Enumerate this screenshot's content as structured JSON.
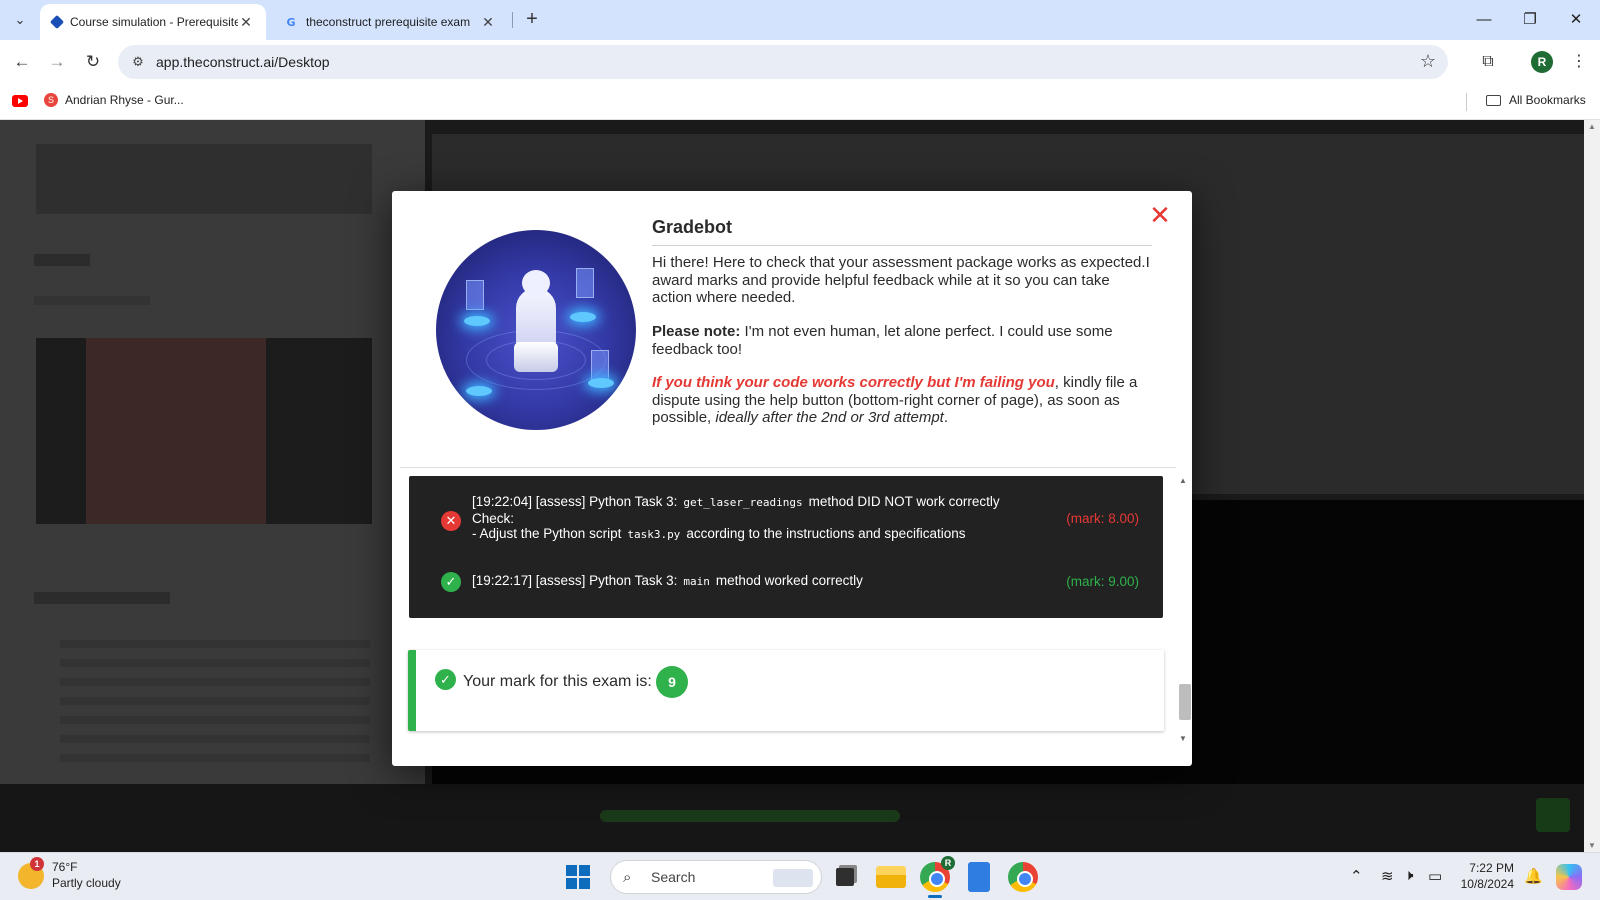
{
  "browser": {
    "tabs": [
      {
        "title": "Course simulation - Prerequisite",
        "active": true,
        "icon": "theconstruct-favicon"
      },
      {
        "title": "theconstruct prerequisite exam",
        "active": false,
        "icon": "google-favicon"
      }
    ],
    "url": "app.theconstruct.ai/Desktop",
    "profile_initial": "R",
    "bookmarks": {
      "items": [
        {
          "label": "Andrian Rhyse - Gur...",
          "icon": "red-favicon"
        }
      ],
      "all_label": "All Bookmarks"
    }
  },
  "modal": {
    "title": "Gradebot",
    "intro": "Hi there! Here to check that your assessment package works as expected.I award marks and provide helpful feedback while at it so you can take action where needed.",
    "note_label": "Please note:",
    "note_text": " I'm not even human, let alone perfect. I could use some feedback too!",
    "dispute_red": "If you think your code works correctly but I'm failing you",
    "dispute_text": ", kindly file a dispute using the help button (bottom-right corner of page), as soon as possible, ",
    "dispute_italic": "ideally after the 2nd or 3rd attempt",
    "dispute_end": ".",
    "log": [
      {
        "status": "fail",
        "prefix": "[19:22:04] [assess] Python Task 3:",
        "code": "get_laser_readings",
        "suffix": "method DID NOT work correctly",
        "line2": "Check:",
        "line3_prefix": "- Adjust the Python script",
        "line3_code": "task3.py",
        "line3_suffix": "according to the instructions and specifications",
        "mark": "(mark: 8.00)"
      },
      {
        "status": "ok",
        "prefix": "[19:22:17] [assess] Python Task 3:",
        "code": "main",
        "suffix": "method worked correctly",
        "mark": "(mark: 9.00)"
      }
    ],
    "result_label": "Your mark for this exam is:",
    "result_score": "9",
    "colors": {
      "fail": "#e53935",
      "ok": "#2fb14b"
    }
  },
  "taskbar": {
    "weather_temp": "76°F",
    "weather_desc": "Partly cloudy",
    "weather_badge": "1",
    "search_placeholder": "Search",
    "time": "7:22 PM",
    "date": "10/8/2024",
    "chrome_badge": "R"
  }
}
